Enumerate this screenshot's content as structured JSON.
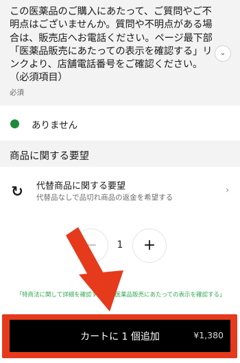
{
  "question": {
    "text": "この医薬品のご購入にあたって、ご質問やご不明点はございませんか。質問や不明点がある場合は、販売店へお電話ください。ページ最下部「医薬品販売にあたっての表示を確認する」リンクより、店舗電話番号をご確認ください。（必須項目）",
    "required_label": "必須",
    "expand_icon": "chevron-down-icon"
  },
  "option": {
    "label": "ありません",
    "selected_color": "#1c8a3c"
  },
  "section": {
    "title": "商品に関する要望"
  },
  "substitution": {
    "icon": "swap-cycle-icon",
    "title": "代替商品に関する要望",
    "description": "代替品なしで品切れ商品の返金を希望する"
  },
  "stepper": {
    "minus": "−",
    "quantity": "1",
    "plus": "+"
  },
  "legal": {
    "link1": "「特商法に関して詳細を確認する」",
    "sep": "、",
    "link2": "「医薬品販売にあたっての表示を確認する」"
  },
  "cart": {
    "label": "カートに 1 個追加",
    "price": "¥1,380"
  },
  "colors": {
    "annotation_red": "#e53a1c",
    "link_green": "#34a853"
  }
}
